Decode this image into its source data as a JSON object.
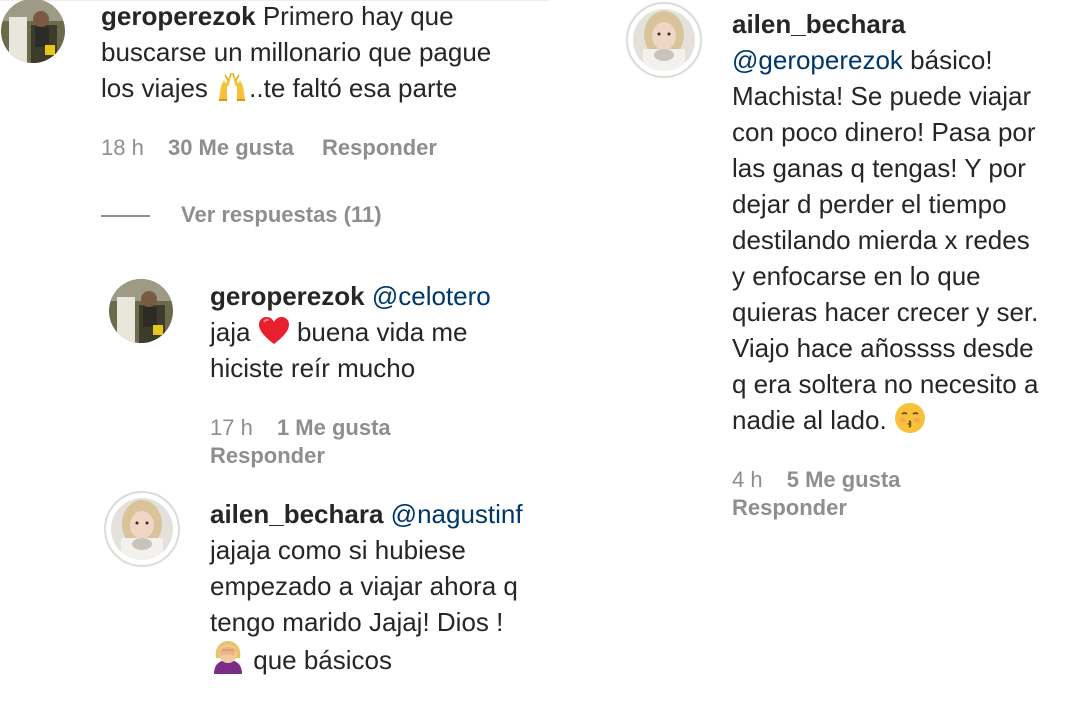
{
  "comments": {
    "c1": {
      "username": "geroperezok",
      "line1_text": "Primero hay que",
      "line2": "buscarse un millonario que pague",
      "line3_a": "los viajes",
      "line3_b": "..te faltó esa parte",
      "emoji_icon": "raising-hands-icon",
      "time": "18 h",
      "likes": "30 Me gusta",
      "reply": "Responder",
      "view_replies": "Ver respuestas (11)"
    },
    "c2": {
      "username": "geroperezok",
      "mention": "@celotero",
      "line2_a": "jaja",
      "line2_b": "buena vida me",
      "line3": "hiciste reír mucho",
      "emoji_icon": "red-heart-icon",
      "time": "17 h",
      "likes": "1 Me gusta",
      "reply": "Responder"
    },
    "c3": {
      "username": "ailen_bechara",
      "mention": "@nagustinf",
      "line2": "jajaja como si hubiese",
      "line3": "empezado a viajar ahora q",
      "line4": "tengo marido Jajaj! Dios !",
      "line5": "que básicos",
      "emoji_icon": "face-palm-icon"
    },
    "c4": {
      "username": "ailen_bechara",
      "mention": "@geroperezok",
      "line2_tail": "básico!",
      "lines": [
        "Machista! Se puede viajar",
        "con poco dinero! Pasa por",
        "las ganas q tengas! Y por",
        "dejar d perder el tiempo",
        "destilando mierda x redes",
        "y enfocarse en lo que",
        "quieras hacer crecer y ser.",
        "Viajo hace añossss desde",
        "q era soltera no necesito a"
      ],
      "last_line": "nadie al lado.",
      "emoji_icon": "kissing-face-icon",
      "time": "4 h",
      "likes": "5 Me gusta",
      "reply": "Responder"
    }
  },
  "colors": {
    "text": "#262626",
    "meta": "#8e8e8e",
    "mention": "#00376b",
    "ring": "#dbdbdb"
  }
}
